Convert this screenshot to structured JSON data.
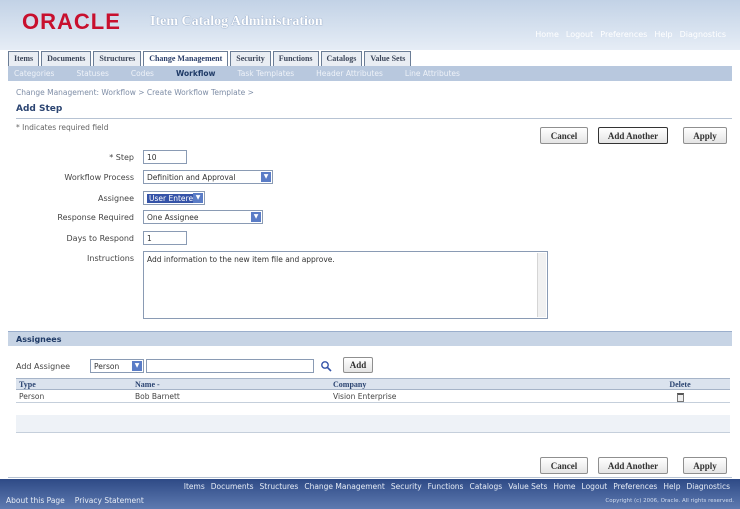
{
  "header": {
    "logo": "ORACLE",
    "title": "Item Catalog Administration",
    "global_links": [
      "Home",
      "Logout",
      "Preferences",
      "Help",
      "Diagnostics"
    ]
  },
  "tabs": [
    "Items",
    "Documents",
    "Structures",
    "Change Management",
    "Security",
    "Functions",
    "Catalogs",
    "Value Sets"
  ],
  "active_tab": "Change Management",
  "subtabs": [
    "Categories",
    "Statuses",
    "Codes",
    "Workflow",
    "Task Templates",
    "Header Attributes",
    "Line Attributes"
  ],
  "active_subtab": "Workflow",
  "breadcrumb": "Change Management: Workflow  >   Create Workflow Template  >",
  "page_title": "Add Step",
  "required_note": "* Indicates required field",
  "buttons": {
    "cancel": "Cancel",
    "add_another": "Add Another",
    "apply": "Apply"
  },
  "form": {
    "step_label": "* Step",
    "step_value": "10",
    "workflow_process_label": "Workflow Process",
    "workflow_process_value": "Definition and Approval",
    "assignee_label": "Assignee",
    "assignee_value": "User Entered",
    "response_required_label": "Response Required",
    "response_required_value": "One Assignee",
    "days_to_respond_label": "Days to Respond",
    "days_to_respond_value": "1",
    "instructions_label": "Instructions",
    "instructions_value": "Add information to the new item file and approve."
  },
  "assignees": {
    "section_title": "Assignees",
    "add_assignee_label": "Add Assignee",
    "add_assignee_type": "Person",
    "add_button": "Add",
    "columns": [
      "Type",
      "Name",
      "Company",
      "Delete"
    ],
    "name_sort_indicator": "-",
    "rows": [
      {
        "type": "Person",
        "name": "Bob Barnett",
        "company": "Vision Enterprise"
      }
    ]
  },
  "footer": {
    "links": [
      "Items",
      "Documents",
      "Structures",
      "Change Management",
      "Security",
      "Functions",
      "Catalogs",
      "Value Sets",
      "Home",
      "Logout",
      "Preferences",
      "Help",
      "Diagnostics"
    ],
    "about": "About this Page",
    "privacy": "Privacy Statement",
    "copyright": "Copyright (c) 2006, Oracle. All rights reserved."
  },
  "colors": {
    "brand": "#c8102e",
    "header_blue": "#2e4a86",
    "select_highlight": "#3553a8"
  },
  "icons": {
    "dropdown": "chevron-down-icon",
    "search": "search-icon",
    "delete": "trash-icon"
  }
}
